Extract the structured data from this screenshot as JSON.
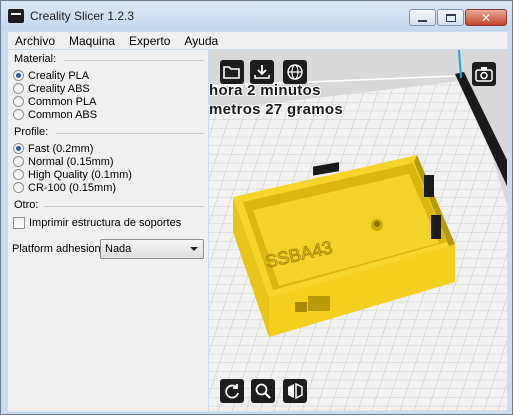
{
  "window": {
    "title": "Creality Slicer 1.2.3",
    "controls": {
      "minimize": "",
      "maximize": "",
      "close": "✕"
    }
  },
  "menu": [
    "Archivo",
    "Maquina",
    "Experto",
    "Ayuda"
  ],
  "material": {
    "title": "Material:",
    "options": [
      "Creality PLA",
      "Creality ABS",
      "Common PLA",
      "Common ABS"
    ],
    "selected": "Creality PLA"
  },
  "profile": {
    "title": "Profile:",
    "options": [
      "Fast (0.2mm)",
      "Normal (0.15mm)",
      "High Quality (0.1mm)",
      "CR-100 (0.15mm)"
    ],
    "selected": "Fast (0.2mm)"
  },
  "other": {
    "title": "Otro:",
    "support_label": "Imprimir estructura de soportes",
    "support_checked": false,
    "adhesion_label": "Platform adhesion",
    "adhesion_value": "Nada"
  },
  "viewport": {
    "info_line1": "hora 2 minutos",
    "info_line2": "metros 27 gramos",
    "model_label": "SSBA43",
    "icons": [
      "folder-open-icon",
      "download-icon",
      "globe-icon",
      "camera-icon",
      "rotate-icon",
      "zoom-icon",
      "mirror-icon"
    ]
  },
  "colors": {
    "model": "#f6d52a",
    "model_shadow": "#b89b08",
    "bed_line": "#b9b9b9",
    "frame_dark": "#1a1a1a",
    "frame_accent": "#1fa6d8",
    "radio_dot": "#2a5b9e"
  }
}
